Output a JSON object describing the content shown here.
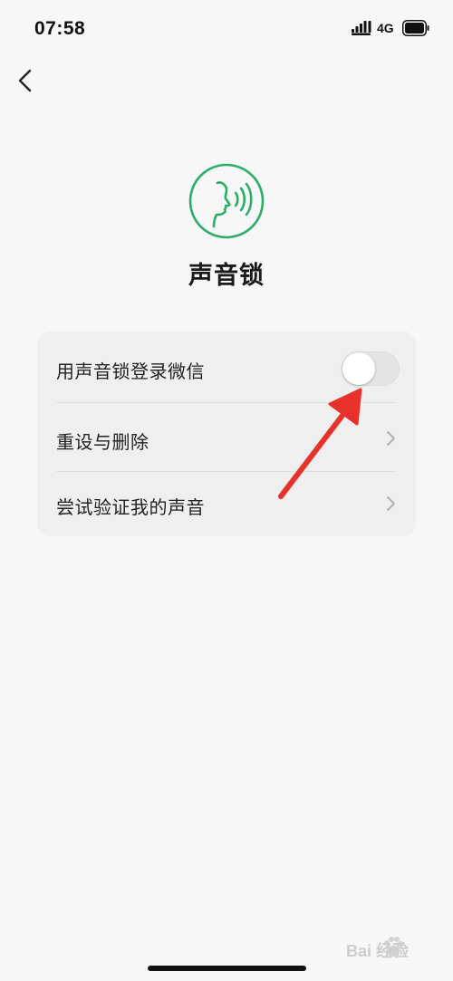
{
  "status_bar": {
    "time": "07:58",
    "network": "4G",
    "signal_icon": "signal-icon",
    "battery_icon": "battery-icon"
  },
  "nav": {
    "back_icon": "chevron-left-icon"
  },
  "header": {
    "icon": "voice-lock-icon",
    "title": "声音锁",
    "accent_color": "#2aae67"
  },
  "settings": {
    "items": [
      {
        "label": "用声音锁登录微信",
        "control": "toggle",
        "enabled": false
      },
      {
        "label": "重设与删除",
        "control": "chevron-right-icon"
      },
      {
        "label": "尝试验证我的声音",
        "control": "chevron-right-icon"
      }
    ]
  },
  "annotation": {
    "arrow_color": "#e8312a",
    "icon": "red-arrow-icon"
  },
  "watermark": {
    "text": "Bai 经验",
    "icon": "paw-icon"
  }
}
